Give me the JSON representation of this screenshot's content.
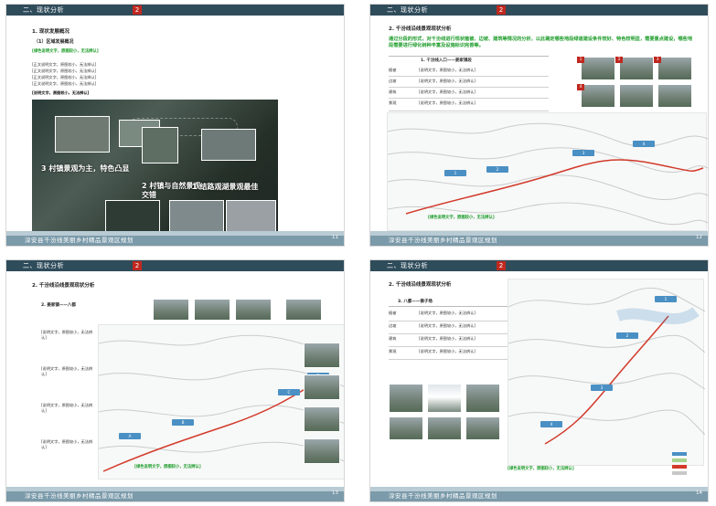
{
  "pages": {
    "p1": {
      "header": "二、现状分析",
      "page_num": "2",
      "h1": "1. 现状发展概况",
      "h2": "（1）区域发展概况",
      "intro_green": "[绿色说明文字，原图较小，无法辨认]",
      "body_lines": [
        "[正文说明文字，原图较小，无法辨认]",
        "[正文说明文字，原图较小，无法辨认]",
        "[正文说明文字，原图较小，无法辨认]",
        "[正文说明文字，原图较小，无法辨认]"
      ],
      "summary": "[说明文字，原图较小，无法辨认]",
      "img_labels": {
        "a": "3 村镇景观为主，特色凸显",
        "b": "2 村镇与自然景观交错",
        "c": "1 结路观湖景观最佳"
      },
      "footer": "淳安县千汾线美丽乡村精品景观区规划",
      "footer_page": "11"
    },
    "p2": {
      "header": "二、现状分析",
      "page_num": "2",
      "h1": "2. 千汾线沿线景观现状分析",
      "intro": "通过分段的形式，对千汾线进行现状植被、边坡、建筑等情况的分析，以此确定哪些地段绿道建设条件较好、特色较明显，需要重点建设，哪些地段需要进行绿化树种丰富及设施标识完善等。",
      "table": {
        "title": "1. 千汾线入口——姜家镇段",
        "rows": [
          {
            "k": "植被",
            "v": "[说明文字，原图较小，无法辨认]"
          },
          {
            "k": "边坡",
            "v": "[说明文字，原图较小，无法辨认]"
          },
          {
            "k": "建筑",
            "v": "[说明文字，原图较小，无法辨认]"
          },
          {
            "k": "景观",
            "v": "[说明文字，原图较小，无法辨认]"
          }
        ]
      },
      "note": "[绿色说明文字，原图较小，无法辨认]",
      "labels": [
        "1",
        "2",
        "3",
        "4"
      ],
      "footer": "淳安县千汾线美丽乡村精品景观区规划",
      "footer_page": "12"
    },
    "p3": {
      "header": "二、现状分析",
      "page_num": "2",
      "h1": "2. 千汾线沿线景观现状分析",
      "seg": "2. 姜家镇——八都",
      "items": [
        {
          "t": "[说明文字，原图较小，无法辨认]"
        },
        {
          "t": "[说明文字，原图较小，无法辨认]"
        },
        {
          "t": "[说明文字，原图较小，无法辨认]"
        },
        {
          "t": "[说明文字，原图较小，无法辨认]"
        }
      ],
      "note": "[绿色说明文字，原图较小，无法辨认]",
      "footer": "淳安县千汾线美丽乡村精品景观区规划",
      "footer_page": "13"
    },
    "p4": {
      "header": "二、现状分析",
      "page_num": "2",
      "h1": "2. 千汾线沿线景观现状分析",
      "seg": "3. 八都——佛子场",
      "table": {
        "rows": [
          {
            "k": "植被",
            "v": "[说明文字，原图较小，无法辨认]"
          },
          {
            "k": "边坡",
            "v": "[说明文字，原图较小，无法辨认]"
          },
          {
            "k": "建筑",
            "v": "[说明文字，原图较小，无法辨认]"
          },
          {
            "k": "景观",
            "v": "[说明文字，原图较小，无法辨认]"
          }
        ]
      },
      "note": "[绿色说明文字，原图较小，无法辨认]",
      "footer": "淳安县千汾线美丽乡村精品景观区规划",
      "footer_page": "14"
    }
  },
  "colors": {
    "header": "#2f4c5b",
    "accent_red": "#c0281f",
    "accent_green": "#1f9d2c",
    "accent_blue": "#4a90c4",
    "footer": "#7b9aaa"
  }
}
